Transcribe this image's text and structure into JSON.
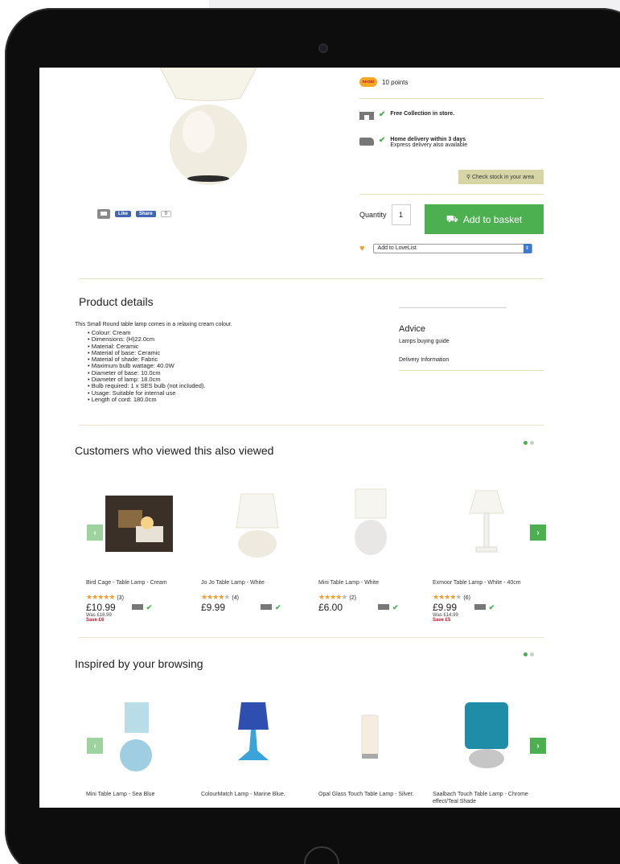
{
  "product": {
    "points": "10 points",
    "nectar_label": "nectar",
    "free_collection": "Free Collection in store.",
    "home_delivery": "Home delivery within 3 days",
    "express_delivery": "Express delivery also available",
    "check_stock": "Check stock in your area",
    "quantity_label": "Quantity",
    "quantity_value": "1",
    "add_to_basket": "Add to basket",
    "add_to_lovelist": "Add to LoveList"
  },
  "social": {
    "like": "Like",
    "share": "Share",
    "count": "0"
  },
  "details": {
    "title": "Product details",
    "intro": "This Small Round table lamp comes in a relaxing cream colour.",
    "specs": [
      "Colour: Cream",
      "Dimensions: (H)22.0cm",
      "Material: Ceramic",
      "Material of base: Ceramic",
      "Material of shade: Fabric",
      "Maximum bulb wattage: 40.0W",
      "Diameter of base: 10.0cm",
      "Diameter of lamp: 18.0cm",
      "Bulb required: 1 x SES bulb (not included).",
      "Usage: Suitable for internal use",
      "Length of cord: 180.0cm"
    ]
  },
  "advice": {
    "title": "Advice",
    "link1": "Lamps buying guide",
    "link2": "Delivery Information"
  },
  "also_viewed": {
    "title": "Customers who viewed this also viewed",
    "items": [
      {
        "name": "Bird Cage - Table Lamp - Cream",
        "rating": 5,
        "count": "(3)",
        "price": "£10.99",
        "was": "Was £16.99",
        "save": "Save £6"
      },
      {
        "name": "Jo Jo Table Lamp - White",
        "rating": 3.5,
        "count": "(4)",
        "price": "£9.99",
        "was": "",
        "save": ""
      },
      {
        "name": "Mini Table Lamp - White",
        "rating": 4,
        "count": "(2)",
        "price": "£6.00",
        "was": "",
        "save": ""
      },
      {
        "name": "Exmoor Table Lamp - White - 40cm",
        "rating": 4,
        "count": "(6)",
        "price": "£9.99",
        "was": "Was £14.99",
        "save": "Save £5"
      }
    ]
  },
  "inspired": {
    "title": "Inspired by your browsing",
    "items": [
      {
        "name": "Mini Table Lamp - Sea Blue"
      },
      {
        "name": "ColourMatch Lamp - Marine Blue."
      },
      {
        "name": "Opal Glass Touch Table Lamp - Silver."
      },
      {
        "name": "Saalbach Touch Table Lamp - Chrome effect/Teal Shade"
      }
    ]
  },
  "icons": {
    "prev": "‹",
    "next": "›",
    "tick": "✔",
    "heart": "♥",
    "pin": "⚲",
    "basket": "⛟"
  },
  "colors": {
    "accent_green": "#4caf50",
    "star_orange": "#f39c2a",
    "save_red": "#c0192c"
  }
}
